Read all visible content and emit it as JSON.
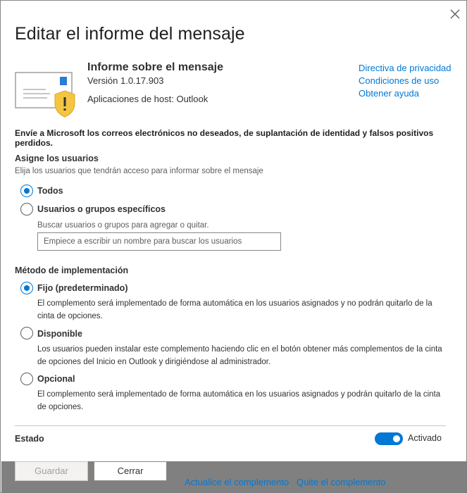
{
  "dialog": {
    "title": "Editar el informe del mensaje",
    "close_label": "Cerrar"
  },
  "app": {
    "name": "Informe sobre el mensaje",
    "version": "Versión 1.0.17.903",
    "host": "Aplicaciones de host: Outlook",
    "links": [
      "Directiva de privacidad",
      "Condiciones de uso",
      "Obtener ayuda"
    ]
  },
  "description": "Envíe a Microsoft los correos electrónicos no deseados, de suplantación de identidad y falsos positivos perdidos.",
  "assign": {
    "title": "Asigne los usuarios",
    "subtitle": "Elija los usuarios que tendrán acceso para informar sobre el mensaje",
    "options": [
      {
        "label": "Todos",
        "selected": true
      },
      {
        "label": "Usuarios o grupos específicos",
        "selected": false
      }
    ],
    "search_label": "Buscar usuarios o grupos para agregar o quitar.",
    "search_placeholder": "Empiece a escribir un nombre para buscar los usuarios",
    "search_value": ""
  },
  "deployment": {
    "title": "Método de implementación",
    "options": [
      {
        "label": "Fijo (predeterminado)",
        "selected": true,
        "desc": "El complemento será implementado de forma automática en los usuarios asignados y no podrán quitarlo de la cinta de opciones."
      },
      {
        "label": "Disponible",
        "selected": false,
        "desc": "Los usuarios pueden instalar este complemento haciendo clic en el botón obtener más complementos de la cinta de opciones del Inicio en Outlook y dirigiéndose al administrador."
      },
      {
        "label": "Opcional",
        "selected": false,
        "desc": "El complemento será implementado de forma automática en los usuarios asignados y podrán quitarlo de la cinta de opciones."
      }
    ]
  },
  "status": {
    "label": "Estado",
    "toggle_on": true,
    "toggle_label": "Activado"
  },
  "footer": {
    "save_label": "Guardar",
    "close_label": "Cerrar",
    "update_link": "Actualice el complemento",
    "remove_link": "Quite el complemento"
  },
  "colors": {
    "accent": "#0078d4",
    "warning": "#f4c542",
    "footer_bg": "#808080"
  }
}
